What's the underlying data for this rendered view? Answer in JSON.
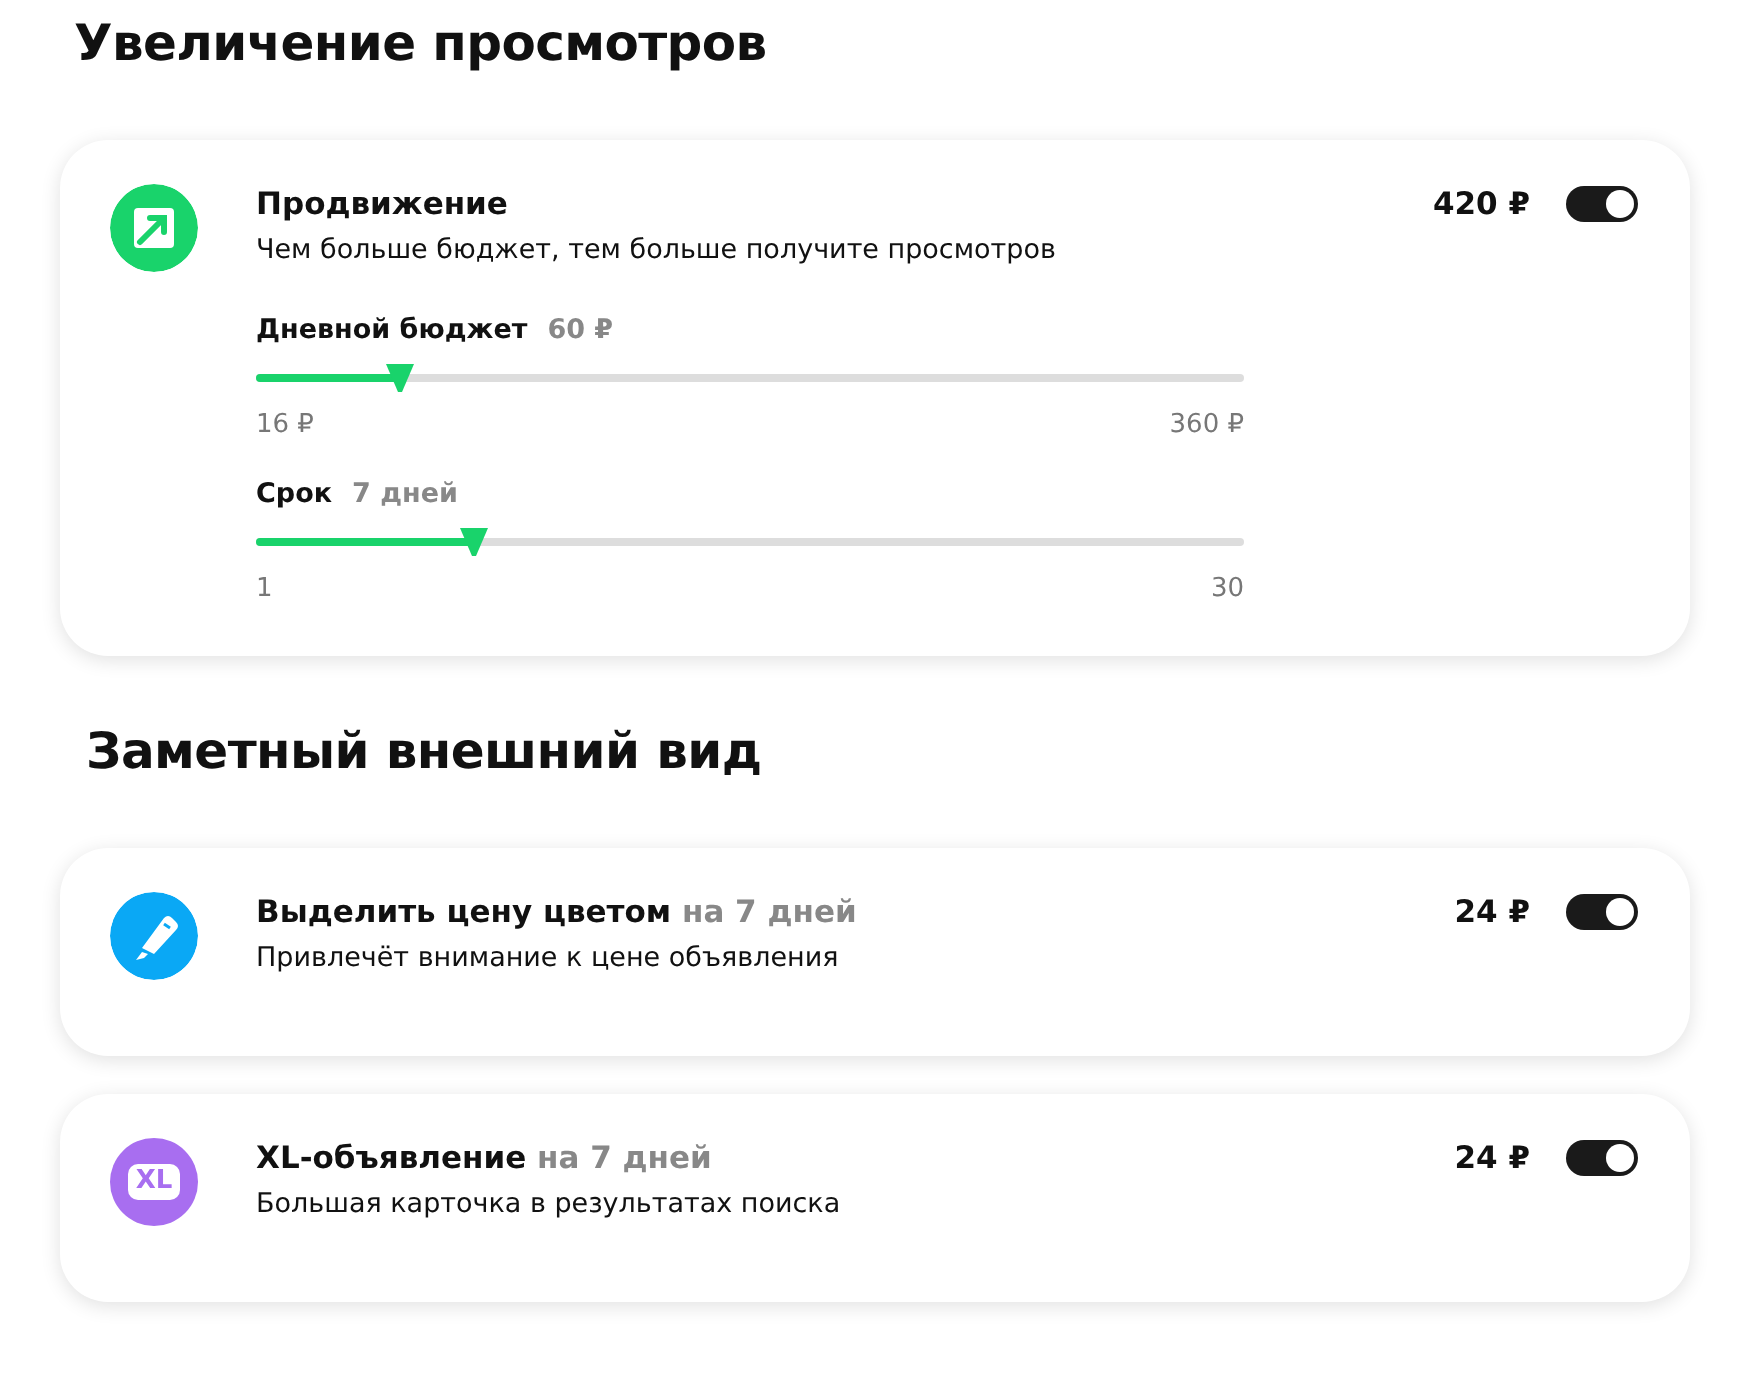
{
  "sections": [
    {
      "title": "Увеличение просмотров",
      "cards": [
        {
          "kind": "promotion",
          "title": "Продвижение",
          "description": "Чем больше бюджет, тем больше получите просмотров",
          "price": "420 ₽",
          "on": true,
          "sliders": [
            {
              "label": "Дневной бюджет",
              "value": "60 ₽",
              "level": 0.146,
              "min": "16 ₽",
              "max": "360 ₽"
            },
            {
              "label": "Срок",
              "value": "7 дней",
              "level": 0.22,
              "min": "1",
              "max": "30"
            }
          ]
        }
      ]
    },
    {
      "title": "Заметный внешний вид",
      "cards": [
        {
          "kind": "highlight",
          "title": "Выделить цену цветом",
          "title_suffix": "на 7 дней",
          "description": "Привлечёт внимание к цене объявления",
          "price": "24 ₽",
          "on": true
        },
        {
          "kind": "xl",
          "icon_text": "XL",
          "title": "XL-объявление",
          "title_suffix": "на 7 дней",
          "description": "Большая карточка в результатах поиска",
          "price": "24 ₽",
          "on": true
        }
      ]
    }
  ]
}
